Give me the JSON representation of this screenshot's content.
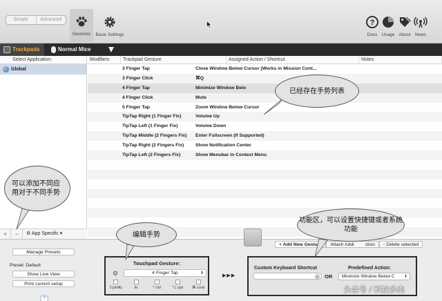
{
  "toolbar": {
    "mode_simple": "Simple",
    "mode_advanced": "Advanced",
    "gestures": "Gestures",
    "basic_settings": "Basic Settings",
    "docs": "Docs",
    "usage": "Usage",
    "about": "About",
    "news": "News"
  },
  "tabs": {
    "trackpads": "Trackpads",
    "normal_mice": "Normal Mice"
  },
  "apps": {
    "header": "Select Application:",
    "global": "Global",
    "app_specific": "App Specific"
  },
  "table": {
    "headers": [
      "Modifiers",
      "Trackpad Gesture",
      "Assigned Action / Shortcut",
      "Notes"
    ],
    "rows": [
      {
        "gesture": "3 Finger Tap",
        "action": "Close Window Below Cursor (Works in Mission Cont..."
      },
      {
        "gesture": "3 Finger Click",
        "action": "⌘Q"
      },
      {
        "gesture": "4 Finger Tap",
        "action": "Minimize Window Belo"
      },
      {
        "gesture": "4 Finger Click",
        "action": "Mute"
      },
      {
        "gesture": "5 Finger Tap",
        "action": "Zoom Window Below Cursor"
      },
      {
        "gesture": "TipTap Right (1 Finger Fix)",
        "action": "Volume Up"
      },
      {
        "gesture": "TipTap Left (1 Finger Fix)",
        "action": "Volume Down"
      },
      {
        "gesture": "TipTap Middle (2 Fingers Fix)",
        "action": "Enter Fullscreen (If Supported)"
      },
      {
        "gesture": "TipTap Right (2 Fingers Fix)",
        "action": "Show Notification Center"
      },
      {
        "gesture": "TipTap Left (2 Fingers Fix)",
        "action": "Show Menubar in Context Menu"
      }
    ]
  },
  "bottom": {
    "manage_presets": "Manage Presets",
    "preset": "Preset: Default",
    "show_live_view": "Show Live View",
    "print_setup": "Print current setup",
    "help": "?",
    "add_gesture": "+ Add New Gesture",
    "attach": "Attach Addi",
    "action_partial": "ction",
    "delete": "- Delete selected"
  },
  "gesture_editor": {
    "title": "Touchpad Gesture:",
    "value": "4 Finger Tap",
    "modifiers": [
      "⇧(shift)",
      "fn",
      "^ ctrl",
      "⌥ opt",
      "⌘ cmd"
    ]
  },
  "arrows": "▶▶▶",
  "shortcut": {
    "custom_title": "Custom Keyboard Shortcut",
    "or": "OR",
    "predefined_title": "Predefined Action:",
    "predefined_value": "Minimize Window Below C"
  },
  "callouts": {
    "list": "已经存在手势列表",
    "add": "可以添加不同应用对于不同手势",
    "edit": "编辑手势",
    "func": "功能区，可以设置快捷键或者系统功能"
  },
  "watermark": "头条号 / 科技多肉"
}
